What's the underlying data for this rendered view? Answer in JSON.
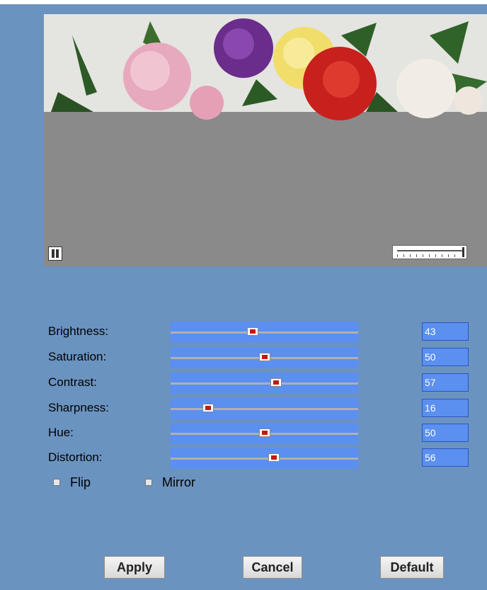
{
  "adjustments": [
    {
      "label": "Brightness:",
      "value": "43",
      "level": 43
    },
    {
      "label": "Saturation:",
      "value": "50",
      "level": 50
    },
    {
      "label": "Contrast:",
      "value": "57",
      "level": 57
    },
    {
      "label": "Sharpness:",
      "value": "16",
      "level": 16
    },
    {
      "label": "Hue:",
      "value": "50",
      "level": 50
    },
    {
      "label": "Distortion:",
      "value": "56",
      "level": 56
    }
  ],
  "options": {
    "flip": {
      "label": "Flip",
      "checked": false
    },
    "mirror": {
      "label": "Mirror",
      "checked": false
    }
  },
  "buttons": {
    "apply": "Apply",
    "cancel": "Cancel",
    "default": "Default"
  },
  "colors": {
    "page_background": "#6b93c0",
    "slider_background": "#5b8ff0",
    "slider_thumb": "#c21a10"
  },
  "preview": {
    "zoom_level": 1.0
  }
}
